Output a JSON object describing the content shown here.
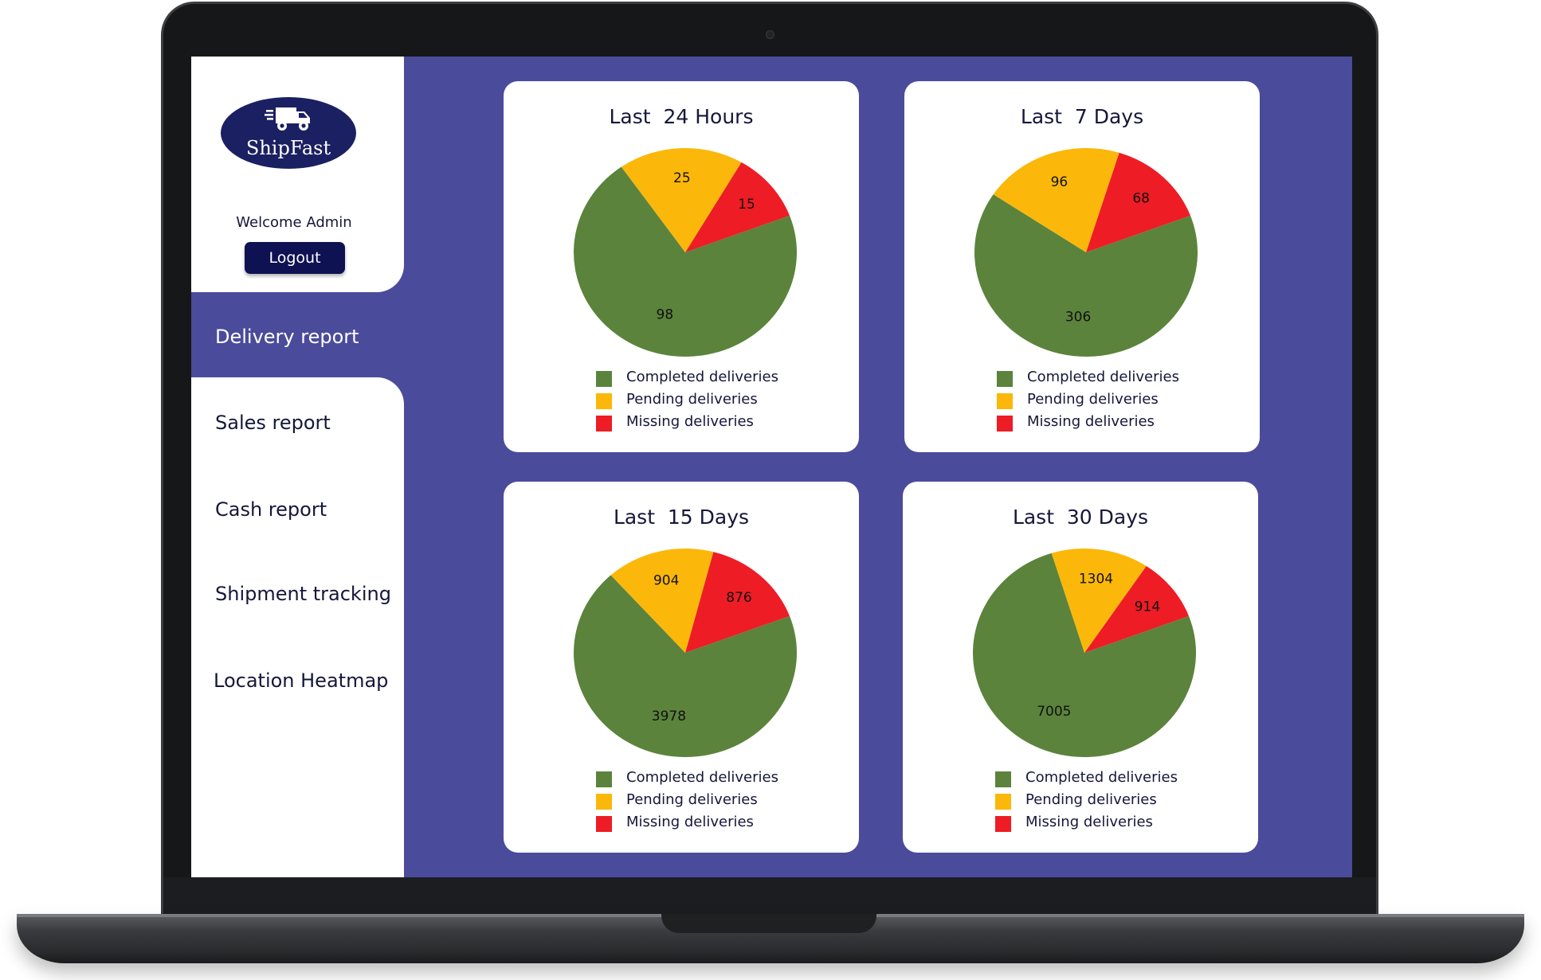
{
  "brand": {
    "name": "ShipFast"
  },
  "user": {
    "welcome": "Welcome Admin",
    "logout_label": "Logout"
  },
  "nav": {
    "items": [
      {
        "label": "Delivery report",
        "active": true
      },
      {
        "label": "Sales report",
        "active": false
      },
      {
        "label": "Cash report",
        "active": false
      },
      {
        "label": "Shipment tracking",
        "active": false
      },
      {
        "label": "Location Heatmap",
        "active": false
      }
    ]
  },
  "icons": {
    "logo": "delivery-truck-icon"
  },
  "colors": {
    "screen_bg": "#4b4b9c",
    "completed": "#5b833c",
    "pending": "#fbb80a",
    "missing": "#ee1c25",
    "logo_bg": "#1b2062",
    "button_bg": "#0e1152"
  },
  "legend": [
    "Completed deliveries",
    "Pending deliveries",
    "Missing deliveries"
  ],
  "chart_data": [
    {
      "type": "pie",
      "title": "Last  24 Hours",
      "categories": [
        "Completed deliveries",
        "Pending deliveries",
        "Missing deliveries"
      ],
      "values": [
        98,
        25,
        15
      ],
      "legend": "bottom"
    },
    {
      "type": "pie",
      "title": "Last  7 Days",
      "categories": [
        "Completed deliveries",
        "Pending deliveries",
        "Missing deliveries"
      ],
      "values": [
        306,
        96,
        68
      ],
      "legend": "bottom"
    },
    {
      "type": "pie",
      "title": "Last  15 Days",
      "categories": [
        "Completed deliveries",
        "Pending deliveries",
        "Missing deliveries"
      ],
      "values": [
        3978,
        904,
        876
      ],
      "legend": "bottom"
    },
    {
      "type": "pie",
      "title": "Last  30 Days",
      "categories": [
        "Completed deliveries",
        "Pending deliveries",
        "Missing deliveries"
      ],
      "values": [
        7005,
        1304,
        914
      ],
      "legend": "bottom"
    }
  ]
}
